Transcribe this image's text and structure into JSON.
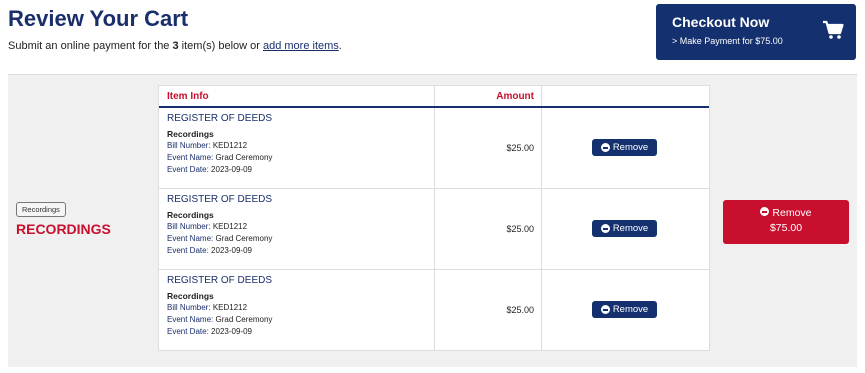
{
  "header": {
    "title": "Review Your Cart",
    "subtitle_pre": "Submit an online payment for the ",
    "item_count": "3",
    "subtitle_mid": " item(s) below or ",
    "add_more_link": "add more items",
    "subtitle_post": "."
  },
  "checkout": {
    "title": "Checkout Now",
    "subtitle": "> Make Payment for $75.00",
    "icon": "cart-icon"
  },
  "category": {
    "badge": "Recordings",
    "name": "RECORDINGS"
  },
  "table": {
    "col_item": "Item Info",
    "col_amount": "Amount",
    "rows": [
      {
        "title": "REGISTER OF DEEDS",
        "category": "Recordings",
        "bill_label": "Bill Number:",
        "bill": "KED1212",
        "event_label": "Event Name:",
        "event": "Grad Ceremony",
        "date_label": "Event Date:",
        "date": "2023-09-09",
        "amount": "$25.00",
        "remove": "Remove"
      },
      {
        "title": "REGISTER OF DEEDS",
        "category": "Recordings",
        "bill_label": "Bill Number:",
        "bill": "KED1212",
        "event_label": "Event Name:",
        "event": "Grad Ceremony",
        "date_label": "Event Date:",
        "date": "2023-09-09",
        "amount": "$25.00",
        "remove": "Remove"
      },
      {
        "title": "REGISTER OF DEEDS",
        "category": "Recordings",
        "bill_label": "Bill Number:",
        "bill": "KED1212",
        "event_label": "Event Name:",
        "event": "Grad Ceremony",
        "date_label": "Event Date:",
        "date": "2023-09-09",
        "amount": "$25.00",
        "remove": "Remove"
      }
    ]
  },
  "remove_all": {
    "label": "Remove",
    "amount": "$75.00"
  },
  "colors": {
    "navy": "#14306e",
    "red": "#c8102e"
  }
}
